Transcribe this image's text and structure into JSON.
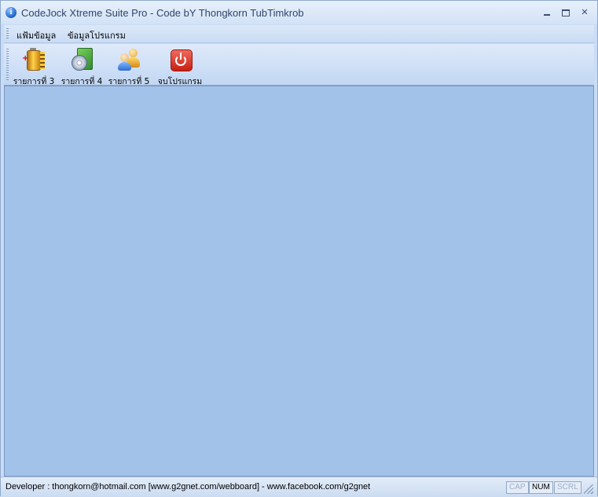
{
  "window": {
    "title": "CodeJock Xtreme Suite Pro - Code bY Thongkorn TubTimkrob",
    "app_icon_glyph": "i",
    "controls": {
      "minimize": "minimize-icon",
      "maximize": "maximize-icon",
      "close_glyph": "✕"
    }
  },
  "menubar": {
    "items": [
      {
        "label": "แฟ้มข้อมูล"
      },
      {
        "label": "ข้อมูลโปรแกรม"
      }
    ]
  },
  "toolbar": {
    "buttons": [
      {
        "label": "รายการที่ 3",
        "icon": "battery-icon"
      },
      {
        "label": "รายการที่ 4",
        "icon": "disc-box-icon"
      },
      {
        "label": "รายการที่ 5",
        "icon": "users-icon"
      },
      {
        "label": "จบโปรแกรม",
        "icon": "power-icon"
      }
    ]
  },
  "statusbar": {
    "text": "Developer : thongkorn@hotmail.com [www.g2gnet.com/webboard] - www.facebook.com/g2gnet",
    "indicators": [
      {
        "label": "CAP",
        "active": false
      },
      {
        "label": "NUM",
        "active": true
      },
      {
        "label": "SCRL",
        "active": false
      }
    ]
  },
  "colors": {
    "client_background": "#a3c2e9",
    "frame": "#c9dcf5",
    "title_text": "#30456b"
  }
}
